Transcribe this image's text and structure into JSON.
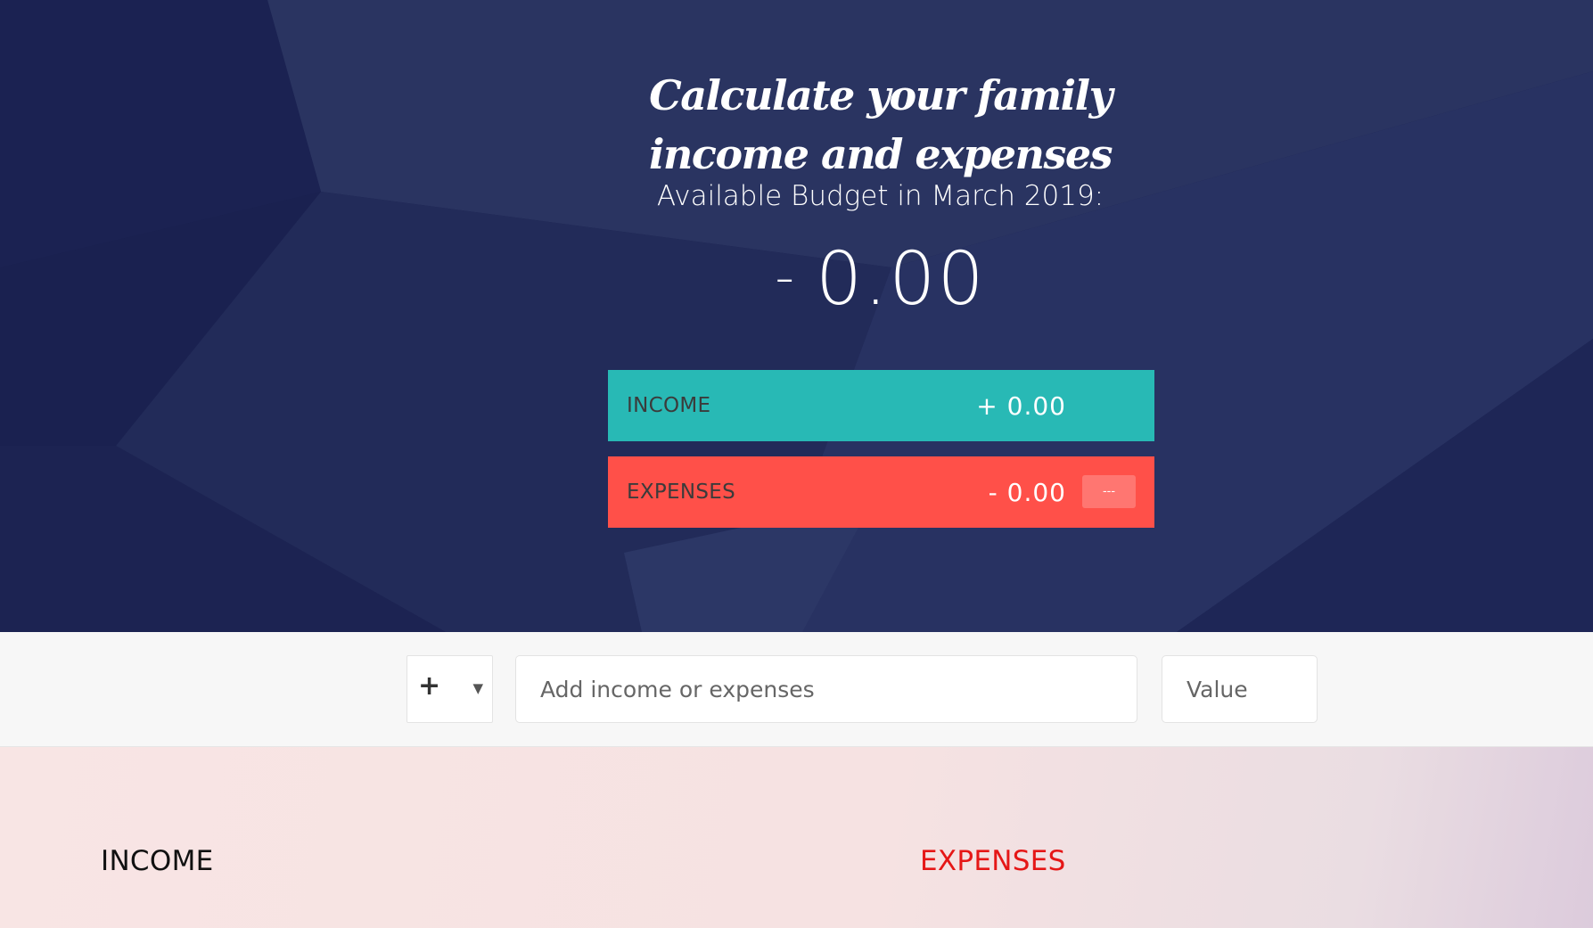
{
  "header": {
    "title": "Calculate your family income and expenses",
    "budget_label": "Available Budget in March 2019:",
    "budget_sign": "-",
    "budget_value": "0.00"
  },
  "summary": {
    "income": {
      "label": "INCOME",
      "value": "+ 0.00",
      "color": "#28b9b5"
    },
    "expenses": {
      "label": "EXPENSES",
      "value": "- 0.00",
      "percentage": "---",
      "color": "#ff5049"
    }
  },
  "add_form": {
    "type_selected": "+",
    "description_placeholder": "Add income or expenses",
    "value_placeholder": "Value"
  },
  "lists": {
    "income_title": "INCOME",
    "expenses_title": "EXPENSES"
  },
  "colors": {
    "hero_bg": "#1d2452",
    "income_accent": "#28b9b5",
    "expenses_accent": "#ff5049",
    "expenses_title": "#e51717"
  }
}
